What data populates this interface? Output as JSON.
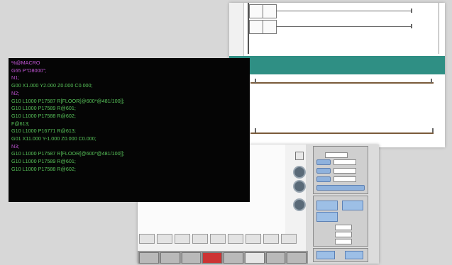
{
  "code_editor": {
    "lines": [
      {
        "text": "%@MACRO",
        "color": "#c256d6"
      },
      {
        "text": "G65 P\"O8000\";",
        "color": "#c256d6"
      },
      {
        "text": "N1;",
        "color": "#c256d6"
      },
      {
        "text": "G00 X1.000 Y2.000 Z0.000 C0.000;",
        "color": "#58c45a"
      },
      {
        "text": "N2;",
        "color": "#c256d6"
      },
      {
        "text": "G10 L1000 P17587 R[FLOOR[@600*@481/100]];",
        "color": "#58c45a"
      },
      {
        "text": "G10 L1000 P17589 R@601;",
        "color": "#58c45a"
      },
      {
        "text": "G10 L1000 P17588 R@602;",
        "color": "#58c45a"
      },
      {
        "text": "F@613;",
        "color": "#58c45a"
      },
      {
        "text": "G10 L1000 P16771 R@613;",
        "color": "#58c45a"
      },
      {
        "text": "G01 X11.000 Y-1.000 Z0.000 C0.000;",
        "color": "#58c45a"
      },
      {
        "text": "N3;",
        "color": "#c256d6"
      },
      {
        "text": "G10 L1000 P17587 R[FLOOR[@600*@481/100]];",
        "color": "#58c45a"
      },
      {
        "text": "G10 L1000 P17589 R@601;",
        "color": "#58c45a"
      },
      {
        "text": "G10 L1000 P17588 R@602;",
        "color": "#58c45a"
      }
    ]
  },
  "ladder": {
    "accent": "#2f8f84"
  },
  "hmi": {
    "accent_blue": "#9dbfe6"
  }
}
